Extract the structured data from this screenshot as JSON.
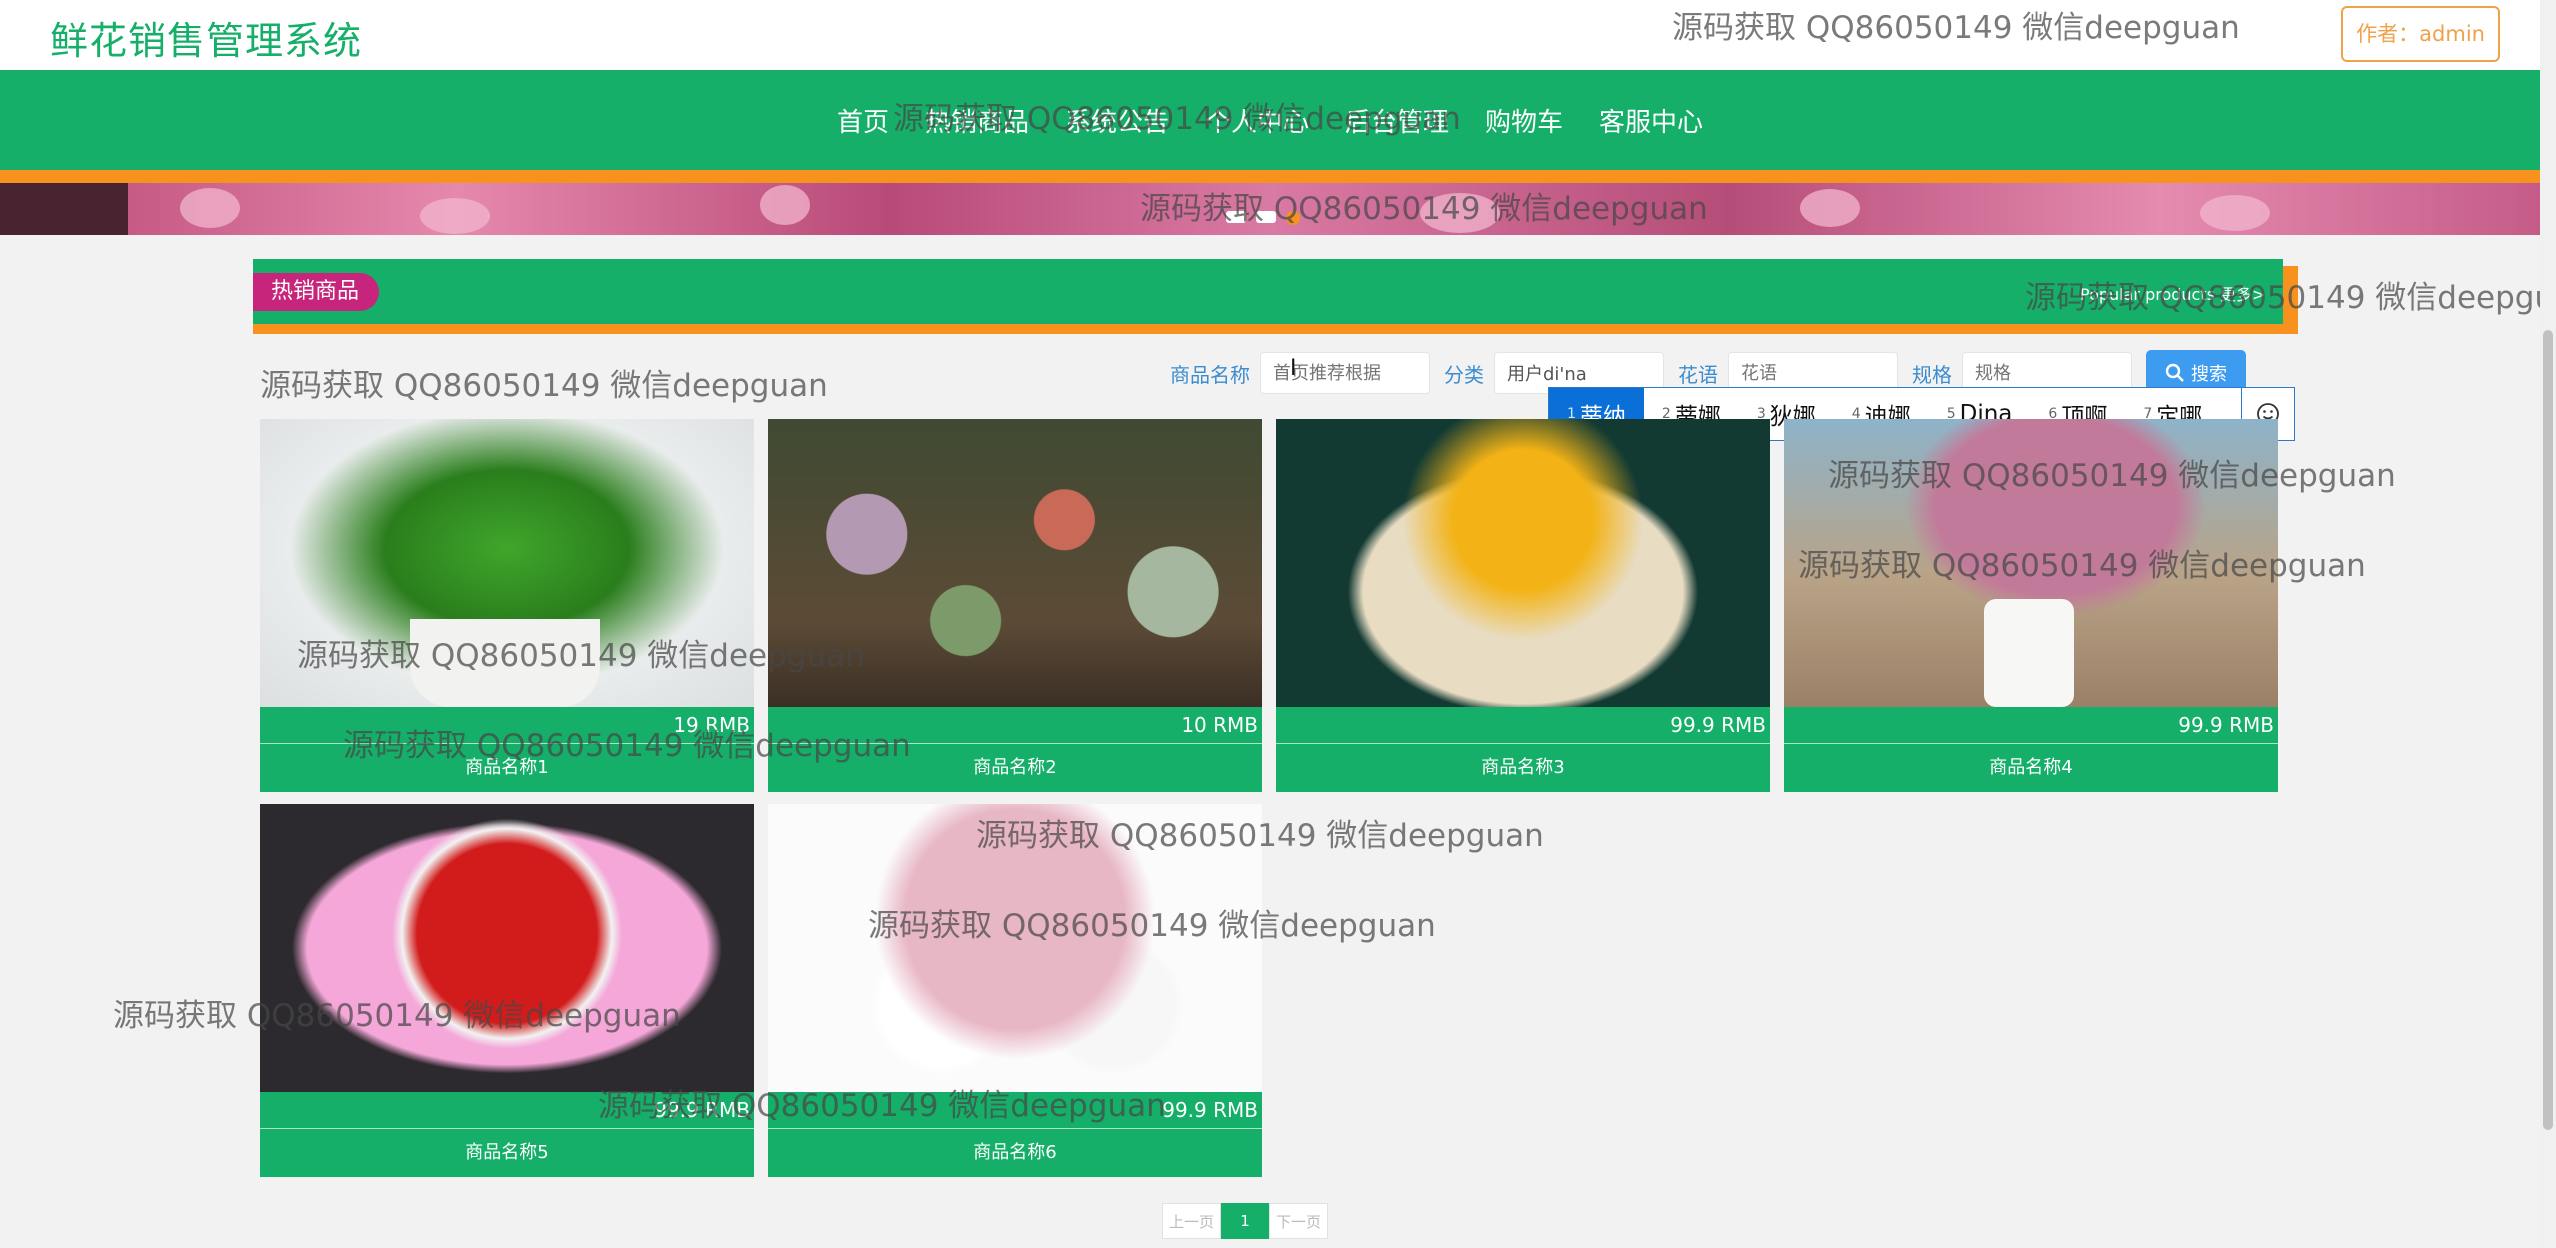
{
  "header": {
    "site_title": "鲜花销售管理系统",
    "author_label": "作者：admin"
  },
  "nav": {
    "items": [
      "首页",
      "热销商品",
      "系统公告",
      "个人中心",
      "后台管理",
      "购物车",
      "客服中心"
    ]
  },
  "section": {
    "title": "热销商品",
    "more": "Popular products  更多>"
  },
  "search": {
    "name_label": "商品名称",
    "name_placeholder": "首页推荐根据",
    "category_label": "分类",
    "category_value": "用户di'na",
    "language_label": "花语",
    "language_placeholder": "花语",
    "spec_label": "规格",
    "spec_placeholder": "规格",
    "button_label": "搜索"
  },
  "ime": {
    "candidates": [
      {
        "num": "1",
        "text": "蒂纳"
      },
      {
        "num": "2",
        "text": "蒂娜"
      },
      {
        "num": "3",
        "text": "狄娜"
      },
      {
        "num": "4",
        "text": "迪娜"
      },
      {
        "num": "5",
        "text": "Dina"
      },
      {
        "num": "6",
        "text": "顶啊"
      },
      {
        "num": "7",
        "text": "定哪"
      }
    ],
    "emoji_icon": "smiley-icon"
  },
  "products": [
    {
      "name": "商品名称1",
      "price": "19 RMB",
      "image": "green pothos plant in white pot"
    },
    {
      "name": "商品名称2",
      "price": "10 RMB",
      "image": "succulent arrangement"
    },
    {
      "name": "商品名称3",
      "price": "99.9 RMB",
      "image": "sunflower bouquet"
    },
    {
      "name": "商品名称4",
      "price": "99.9 RMB",
      "image": "dried pink flowers in white vase"
    },
    {
      "name": "商品名称5",
      "price": "99.9 RMB",
      "image": "red rose bouquet with teddy bears"
    },
    {
      "name": "商品名称6",
      "price": "99.9 RMB",
      "image": "pink and white flower basket"
    }
  ],
  "pagination": {
    "prev": "上一页",
    "current": "1",
    "next": "下一页"
  },
  "watermark": {
    "text": "源码获取 QQ86050149 微信deepguan"
  },
  "colors": {
    "primary": "#15af69",
    "accent": "#f7921e",
    "badge": "#c7247b",
    "search_button": "#3d9cef"
  }
}
